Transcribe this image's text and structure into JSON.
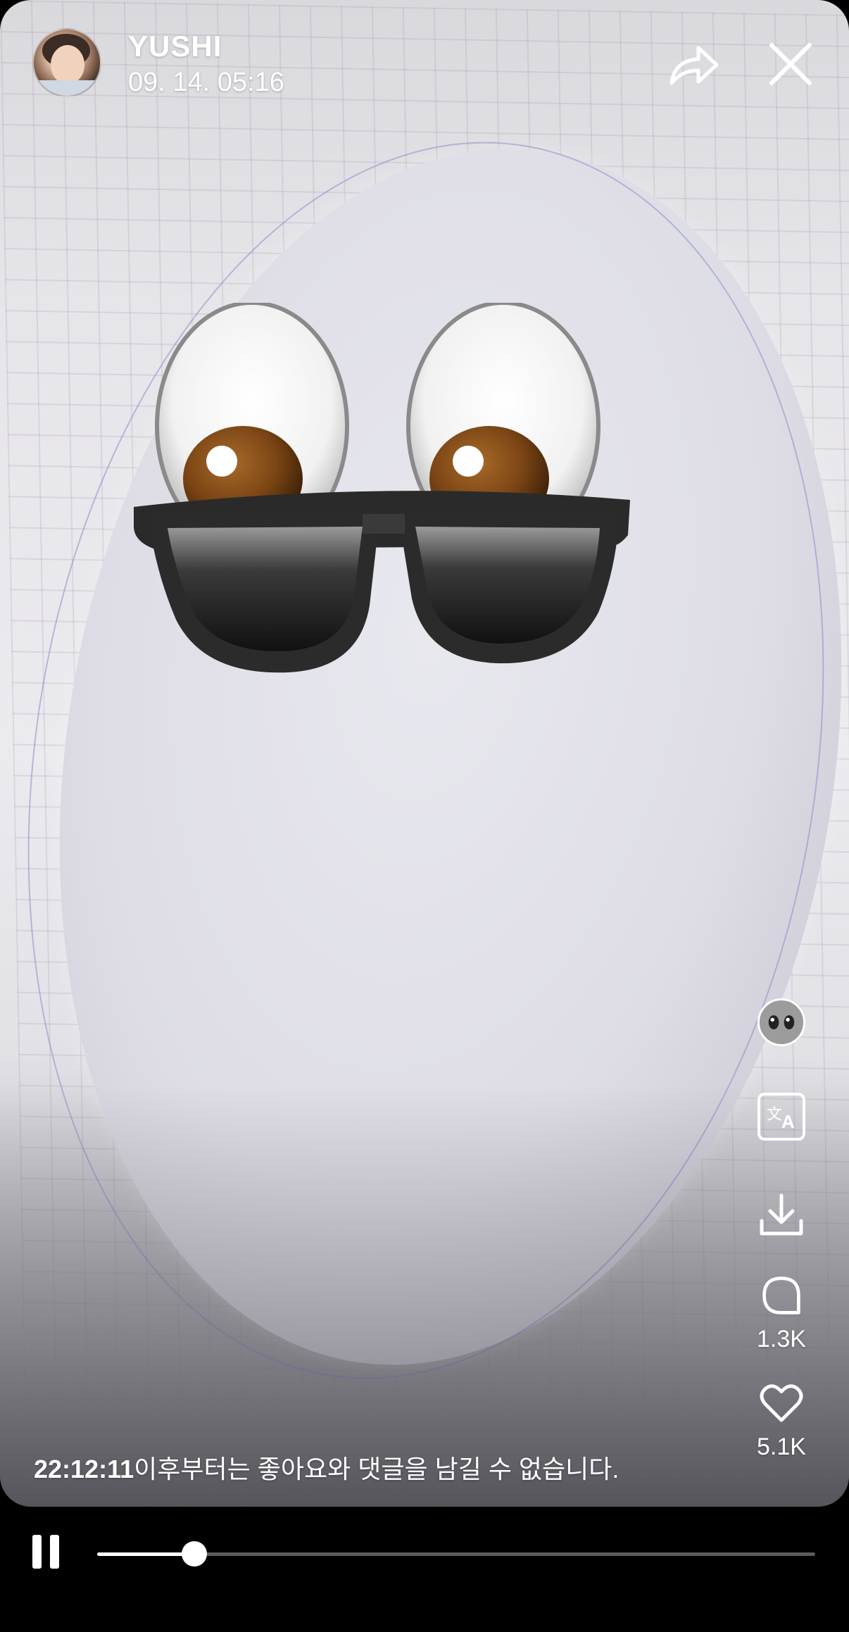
{
  "header": {
    "username": "YUSHI",
    "timestamp": "09. 14. 05:16",
    "avatar_icon": "user-avatar",
    "share_icon": "share-arrow-icon",
    "close_icon": "close-icon"
  },
  "content": {
    "image_subject": "ghost-with-sunglasses"
  },
  "side_rail": {
    "profile_icon": "mini-avatar",
    "translate_icon": "translate-icon",
    "download_icon": "download-icon",
    "comment_icon": "comment-bubble-icon",
    "comment_count": "1.3K",
    "like_icon": "heart-icon",
    "like_count": "5.1K"
  },
  "notice": {
    "time": "22:12:11",
    "message": "이후부터는 좋아요와 댓글을 남길 수 없습니다."
  },
  "player": {
    "state": "playing",
    "pause_icon": "pause-icon",
    "progress": 0.135
  }
}
